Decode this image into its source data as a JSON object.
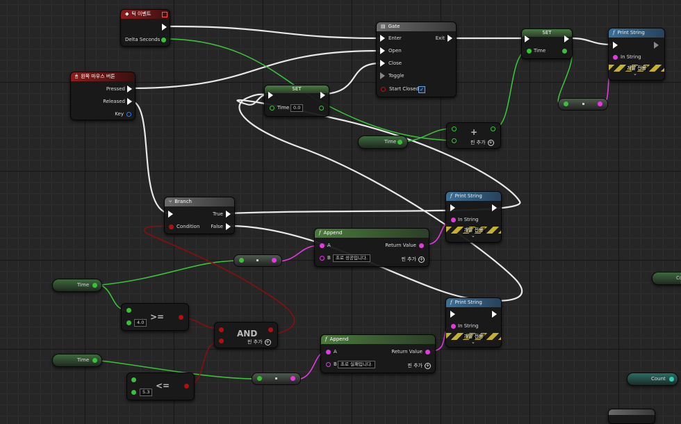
{
  "tick_event": {
    "title": "틱 이벤트",
    "delta_seconds": "Delta Seconds"
  },
  "mouse_event": {
    "title": "왼쪽 마우스 버튼",
    "pressed": "Pressed",
    "released": "Released",
    "key": "Key"
  },
  "gate": {
    "title": "Gate",
    "enter": "Enter",
    "open": "Open",
    "close": "Close",
    "toggle": "Toggle",
    "start_closed": "Start Closed",
    "exit": "Exit"
  },
  "set_node_1": {
    "title": "SET",
    "time_label": "Time",
    "time_value": "0.0"
  },
  "set_node_2": {
    "title": "SET",
    "time_label": "Time"
  },
  "print_string_1": {
    "title": "Print String",
    "in_string": "In String",
    "dev_only": "개발 전용"
  },
  "print_string_2": {
    "title": "Print String",
    "in_string": "In String",
    "dev_only": "개발 전용"
  },
  "print_string_3": {
    "title": "Print String",
    "in_string": "In String",
    "dev_only": "개발 전용"
  },
  "add_node": {
    "symbol": "+",
    "add_pin": "핀 추가"
  },
  "time_getter_top": {
    "label": "Time"
  },
  "branch": {
    "title": "Branch",
    "condition": "Condition",
    "true_label": "True",
    "false_label": "False"
  },
  "append_1": {
    "title": "Append",
    "a": "A",
    "b": "B",
    "b_value": "초로 성공입니다.",
    "return_value": "Return Value",
    "add_pin": "핀 추가"
  },
  "append_2": {
    "title": "Append",
    "a": "A",
    "b": "B",
    "b_value": "초로 실패입니다.",
    "return_value": "Return Value",
    "add_pin": "핀 추가"
  },
  "time_getter_1": {
    "label": "Time"
  },
  "time_getter_2": {
    "label": "Time"
  },
  "gte_node": {
    "symbol": ">=",
    "value": "4.0"
  },
  "lte_node": {
    "symbol": "<=",
    "value": "5.3"
  },
  "and_node": {
    "title": "AND",
    "add_pin": "핀 추가"
  },
  "count_getter": {
    "label": "Count"
  },
  "right_edge_getter": {
    "label": "Co"
  },
  "colors": {
    "exec": "#ffffff",
    "float": "#39c239",
    "string": "#e13be0",
    "bool": "#b01010",
    "int": "#33cbb4",
    "event_header": "#8d1c1c",
    "function_header": "#3c6f95",
    "pure_header": "#4b7a3d"
  }
}
